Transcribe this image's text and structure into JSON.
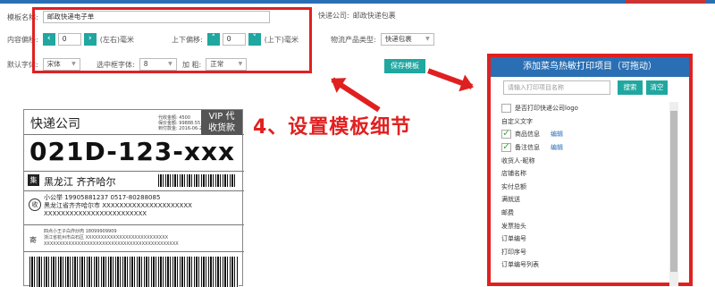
{
  "colors": {
    "accent": "#1fa7a0",
    "brand_blue": "#2a6fb4",
    "annotation_red": "#e02020"
  },
  "form": {
    "template_name_label": "模板名称:",
    "template_name_value": "邮政快递电子单",
    "express_company_label": "快递公司:",
    "express_company_value": "邮政快递包裹",
    "content_offset_label": "内容偏移:",
    "lr_value": "0",
    "lr_unit": "(左右)毫米",
    "ud_offset_label": "上下偏移:",
    "ud_value": "0",
    "ud_unit": "(上下)毫米",
    "product_type_label": "物流产品类型:",
    "product_type_value": "快递包裹",
    "default_font_label": "默认字体:",
    "default_font_value": "宋体",
    "font_size_label": "选中框字体:",
    "font_size_value": "8",
    "bold_label": "加 粗:",
    "bold_value": "正常",
    "save_label": "保存模板"
  },
  "label_preview": {
    "company": "快递公司",
    "small_line1": "代收金额: 4500",
    "small_line2": "保价金额: 99888.55",
    "small_line3": "到付款金: 2016-06-22 18:00 21.00",
    "vip_line1": "VIP 代",
    "vip_line2": "收货款",
    "code": "021D-123-xxx",
    "city_badge": "集",
    "city": "黑龙江  齐齐哈尔",
    "recv_badge": "收",
    "recv_line1": "小公举   19905881237   0517-80288085",
    "recv_line2": "黑龙江省齐齐哈尔市 XXXXXXXXXXXXXXXXXXXXX",
    "recv_line3": "XXXXXXXXXXXXXXXXXXXXXXXX",
    "send_badge": "寄",
    "send_line1": "四点小王子白炸炒肉   18099909909",
    "send_line2": "浙江省杭州市白石区 XXXXXXXXXXXXXXXXXXXXXXXXXXX",
    "send_line3": "XXXXXXXXXXXXXXXXXXXXXXXXXXXXXXXXXXXXXXXXXXXX"
  },
  "annotation": {
    "text": "4、设置模板细节"
  },
  "panel": {
    "title": "添加菜鸟热敏打印项目（可拖动）",
    "search_placeholder": "请输入打印项目名称",
    "search_label": "搜索",
    "clear_label": "清空",
    "edit_label": "编辑",
    "items": [
      {
        "label": "是否打印快递公司logo",
        "check": "box"
      },
      {
        "label": "自定义文字",
        "check": "none"
      },
      {
        "label": "商品信息",
        "check": "checked",
        "edit": true
      },
      {
        "label": "备注信息",
        "check": "checked",
        "edit": true
      },
      {
        "label": "收货人-昵称",
        "check": "none"
      },
      {
        "label": "店铺名称",
        "check": "none"
      },
      {
        "label": "实付总额",
        "check": "none"
      },
      {
        "label": "满就送",
        "check": "none"
      },
      {
        "label": "邮费",
        "check": "none"
      },
      {
        "label": "发票抬头",
        "check": "none"
      },
      {
        "label": "订单编号",
        "check": "none"
      },
      {
        "label": "打印序号",
        "check": "none"
      },
      {
        "label": "订单编号列表",
        "check": "none"
      }
    ]
  }
}
